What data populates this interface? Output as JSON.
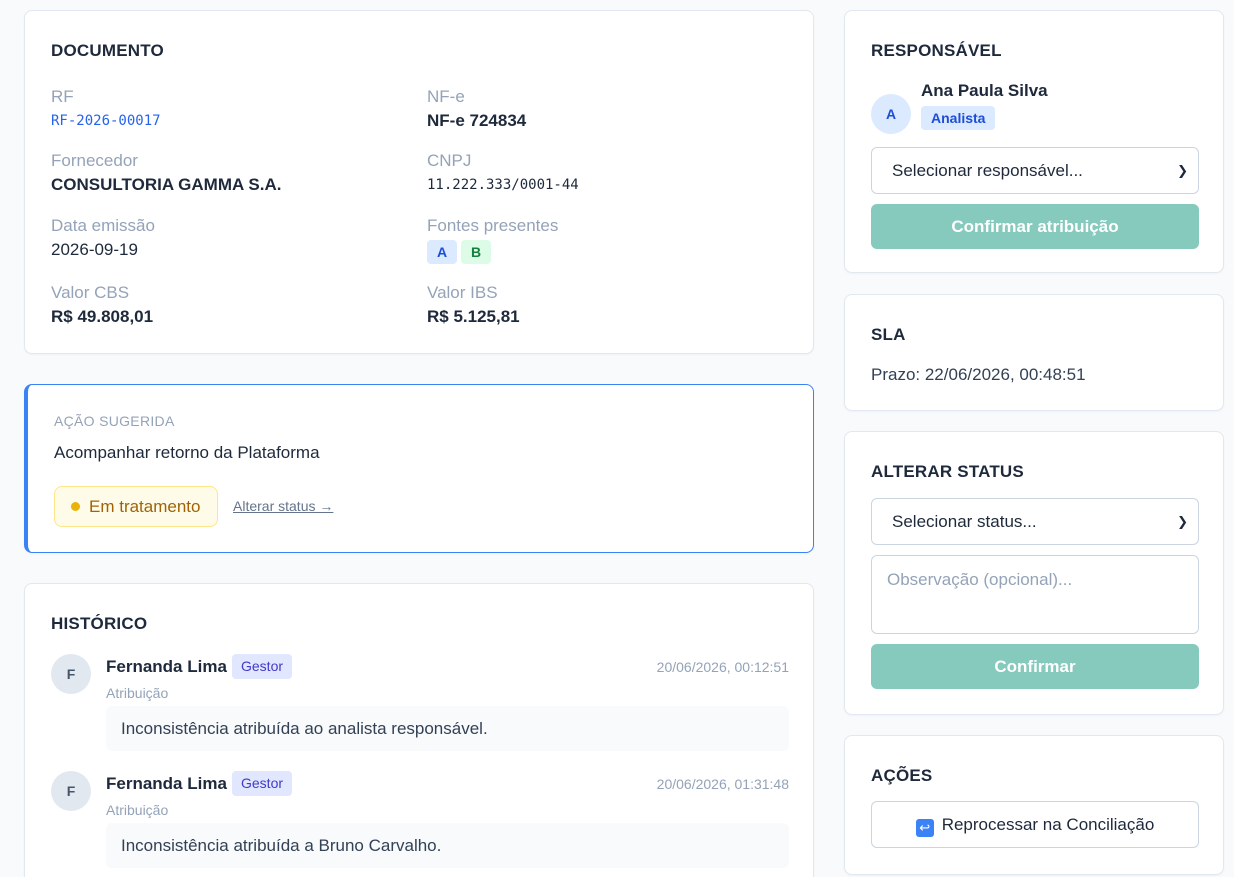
{
  "documento": {
    "title": "DOCUMENTO",
    "rf_label": "RF",
    "rf_value": "RF-2026-00017",
    "nfe_label": "NF-e",
    "nfe_value": "NF-e 724834",
    "fornecedor_label": "Fornecedor",
    "fornecedor_value": "CONSULTORIA GAMMA S.A.",
    "cnpj_label": "CNPJ",
    "cnpj_value": "11.222.333/0001-44",
    "data_label": "Data emissão",
    "data_value": "2026-09-19",
    "fontes_label": "Fontes presentes",
    "fontes": [
      "A",
      "B"
    ],
    "cbs_label": "Valor CBS",
    "cbs_value": "R$ 49.808,01",
    "ibs_label": "Valor IBS",
    "ibs_value": "R$ 5.125,81"
  },
  "acao": {
    "label": "AÇÃO SUGERIDA",
    "text": "Acompanhar retorno da Plataforma",
    "status": "Em tratamento",
    "status_link": "Alterar status →"
  },
  "historico": {
    "title": "HISTÓRICO",
    "items": [
      {
        "initial": "F",
        "name": "Fernanda Lima",
        "role": "Gestor",
        "time": "20/06/2026, 00:12:51",
        "type": "Atribuição",
        "message": "Inconsistência atribuída ao analista responsável."
      },
      {
        "initial": "F",
        "name": "Fernanda Lima",
        "role": "Gestor",
        "time": "20/06/2026, 01:31:48",
        "type": "Atribuição",
        "message": "Inconsistência atribuída a Bruno Carvalho."
      }
    ]
  },
  "responsavel": {
    "title": "RESPONSÁVEL",
    "initial": "A",
    "name": "Ana Paula Silva",
    "role": "Analista",
    "select_value": "Selecionar responsável...",
    "confirm_label": "Confirmar atribuição"
  },
  "sla": {
    "title": "SLA",
    "text": "Prazo: 22/06/2026, 00:48:51"
  },
  "alterar_status": {
    "title": "ALTERAR STATUS",
    "select_value": "Selecionar status...",
    "textarea_placeholder": "Observação (opcional)...",
    "confirm_label": "Confirmar"
  },
  "acoes": {
    "title": "AÇÕES",
    "icon": "↩",
    "reprocess_label": "Reprocessar na Conciliação"
  },
  "colors": {
    "accent": "#3b82f6",
    "button_teal": "#86c9bd",
    "status_yellow": "#eab308"
  }
}
